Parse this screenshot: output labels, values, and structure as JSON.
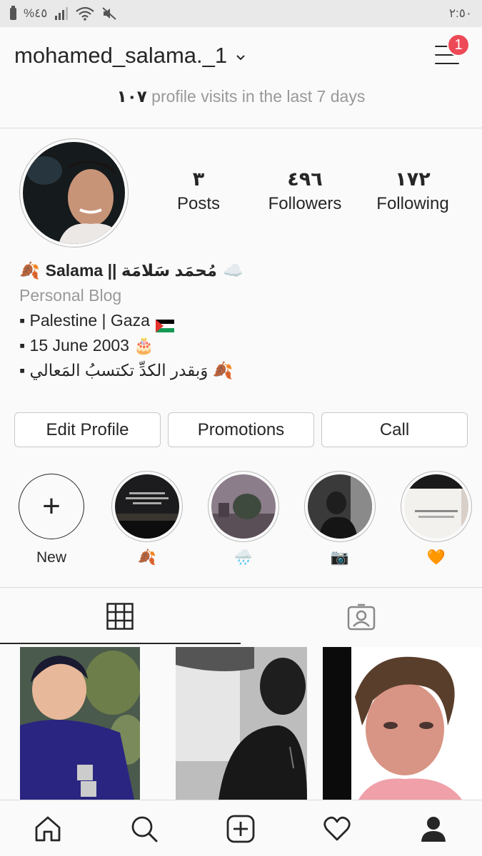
{
  "status_bar": {
    "left": "%٤٥",
    "time": "٢:٥٠"
  },
  "header": {
    "username": "mohamed_salama._1",
    "notification_count": "1",
    "visits_count": "١٠٧",
    "visits_text": " profile visits in the last 7 days"
  },
  "stats": [
    {
      "value": "٣",
      "label": "Posts"
    },
    {
      "value": "٤٩٦",
      "label": "Followers"
    },
    {
      "value": "١٧٢",
      "label": "Following"
    }
  ],
  "bio": {
    "display_name": "Salama || مُحمَد سَلامَة",
    "category": "Personal Blog",
    "lines": [
      "▪ Palestine | Gaza",
      "▪ 15 June 2003 🎂",
      "▪ وَبقدر الكدِّ تكتسبُ المَعالي 🍂"
    ]
  },
  "buttons": {
    "edit": "Edit Profile",
    "promotions": "Promotions",
    "call": "Call"
  },
  "highlights": [
    {
      "label": "New"
    },
    {
      "label": "🍂"
    },
    {
      "label": "🌧️"
    },
    {
      "label": "📷"
    },
    {
      "label": "🧡"
    }
  ],
  "colors": {
    "badge": "#ed4956",
    "text": "#262626",
    "muted": "#999999",
    "border": "#dbdbdb"
  }
}
